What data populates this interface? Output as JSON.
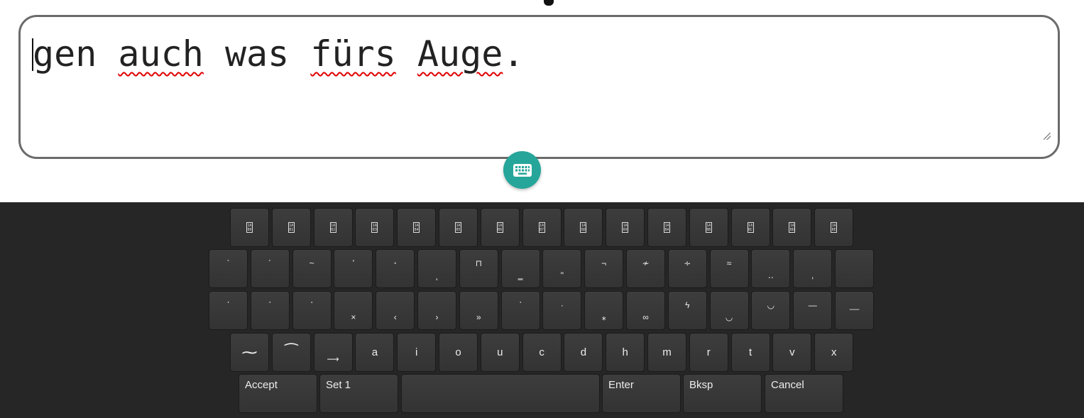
{
  "editor": {
    "words": [
      "gen",
      "auch",
      "was",
      "fürs",
      "Auge",
      "."
    ],
    "spell_flagged": [
      "auch",
      "fürs",
      "Auge"
    ]
  },
  "keyboard_toggle": {
    "icon": "keyboard-icon",
    "color": "#26a69a"
  },
  "keyboard": {
    "rows": [
      [
        "1A\nB0",
        "1A\nB1",
        "1A\nB2",
        "1A\nB3",
        "1A\nB4",
        "1A\nB5",
        "1A\nB6",
        "1A\nB7",
        "1A\nB8",
        "1A\nB9",
        "1A\nBA",
        "1A\nBB",
        "1A\nBC",
        "1A\nBD",
        "1A\nBE"
      ],
      [
        "`",
        "´",
        "~",
        "̓",
        "᷵",
        "̨",
        "⊓",
        "‗",
        "\"",
        "¬",
        "≁",
        "∻",
        "≈",
        "‥",
        ",",
        ""
      ],
      [
        "᾽",
        "῾",
        "᷾",
        "×",
        "‹",
        "›",
        "»",
        "᾿",
        "·",
        "⁎",
        "∞",
        "ϟ",
        "◡",
        "◡",
        "—",
        "__"
      ],
      [
        "⁓",
        "⁀",
        "⟶",
        "a",
        "i",
        "o",
        "u",
        "c",
        "d",
        "h",
        "m",
        "r",
        "t",
        "v",
        "x"
      ]
    ],
    "bottom": {
      "accept": "Accept",
      "set": "Set 1",
      "space": "",
      "enter": "Enter",
      "bksp": "Bksp",
      "cancel": "Cancel"
    }
  }
}
